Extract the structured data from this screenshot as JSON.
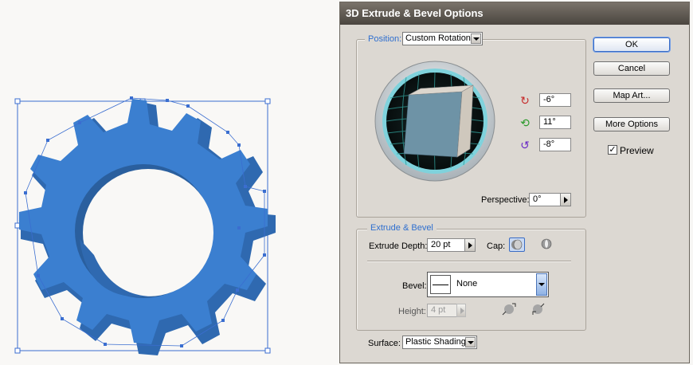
{
  "dialog": {
    "title": "3D Extrude & Bevel Options",
    "position": {
      "legend": "Position:",
      "value": "Custom Rotation"
    },
    "rotation": {
      "x": "-6°",
      "y": "11°",
      "z": "-8°"
    },
    "perspective": {
      "label": "Perspective:",
      "value": "0°"
    },
    "extrude_bevel": {
      "legend": "Extrude & Bevel",
      "depth_label": "Extrude Depth:",
      "depth_value": "20 pt",
      "cap_label": "Cap:",
      "bevel_label": "Bevel:",
      "bevel_value": "None",
      "height_label": "Height:",
      "height_value": "4 pt"
    },
    "surface": {
      "label": "Surface:",
      "value": "Plastic Shading"
    },
    "buttons": {
      "ok": "OK",
      "cancel": "Cancel",
      "map_art": "Map Art...",
      "more_options": "More Options"
    },
    "preview": {
      "label": "Preview",
      "checked": true,
      "mark": "✓"
    }
  },
  "colors": {
    "gear": "#3b7fd0",
    "legend": "#2f6fcf",
    "cube_face": "#6e93a6"
  },
  "icons": [
    "x-axis-rotation-icon",
    "y-axis-rotation-icon",
    "z-axis-rotation-icon",
    "cap-on-icon",
    "cap-off-icon",
    "bevel-out-icon",
    "bevel-in-icon"
  ]
}
